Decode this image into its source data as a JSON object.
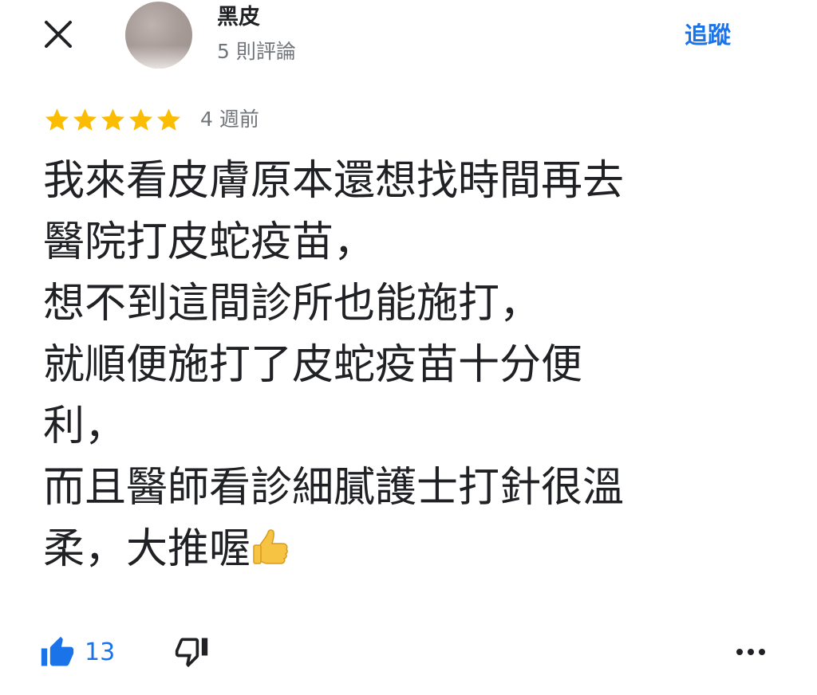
{
  "header": {
    "user_name": "黑皮",
    "review_count": "5 則評論",
    "follow_label": "追蹤"
  },
  "review": {
    "rating": 5,
    "max_rating": 5,
    "time": "4 週前",
    "text_lines": [
      "我來看皮膚原本還想找時間再去",
      "醫院打皮蛇疫苗，",
      "想不到這間診所也能施打，",
      "就順便施打了皮蛇疫苗十分便",
      "利，",
      "而且醫師看診細膩護士打針很溫",
      "柔，大推喔"
    ]
  },
  "actions": {
    "like_count": "13"
  },
  "colors": {
    "accent": "#1a73e8",
    "star": "#fbbc04",
    "secondary_text": "#70757a"
  },
  "icons": {
    "close": "close-icon",
    "like": "thumbs-up-icon",
    "dislike": "thumbs-down-icon",
    "more": "more-horizontal-icon",
    "emoji": "thumbs-up-emoji"
  }
}
